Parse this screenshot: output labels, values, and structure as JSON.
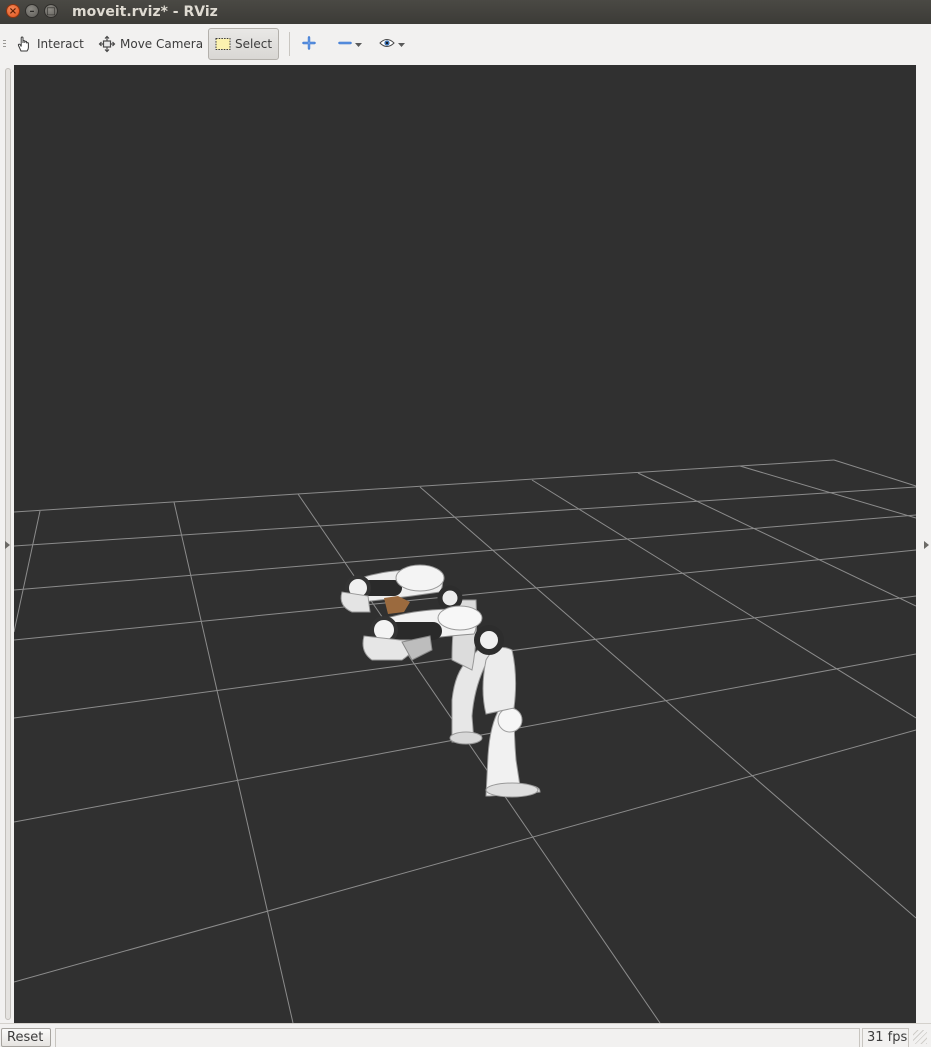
{
  "window": {
    "title": "moveit.rviz* - RViz",
    "close_glyph": "×",
    "minimize_glyph": "–",
    "maximize_glyph": "□"
  },
  "toolbar": {
    "tools": [
      {
        "label": "Interact",
        "icon": "hand-icon",
        "active": false
      },
      {
        "label": "Move Camera",
        "icon": "move-camera-icon",
        "active": false
      },
      {
        "label": "Select",
        "icon": "select-box-icon",
        "active": true
      }
    ],
    "add_tool_icon": "plus-icon",
    "remove_tool_icon": "minus-icon",
    "visibility_icon": "eye-icon"
  },
  "viewport": {
    "background": "#303030",
    "grid_color": "#a0a0a0",
    "content": "Panda robot arm model (planning and goal states) on a reference grid"
  },
  "status": {
    "reset_label": "Reset",
    "fps": "31 fps"
  }
}
